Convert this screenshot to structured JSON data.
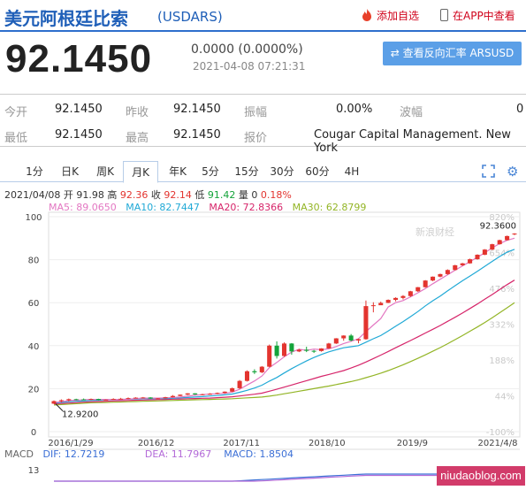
{
  "header": {
    "title": "美元阿根廷比索",
    "code": "(USDARS)",
    "fav_label": "添加自选",
    "app_label": "在APP中查看"
  },
  "quote": {
    "price": "92.1450",
    "change": "0.0000 (0.0000%)",
    "time": "2021-04-08 07:21:31",
    "reverse_button": "查看反向汇率 ARSUSD"
  },
  "stats": {
    "open_label": "今开",
    "open": "92.1450",
    "prev_label": "昨收",
    "prev": "92.1450",
    "amp_label": "振幅",
    "amp": "0.00%",
    "wave_label": "波幅",
    "wave": "0",
    "low_label": "最低",
    "low": "92.1450",
    "high_label": "最高",
    "high": "92.1450",
    "quote_label": "报价",
    "quoter": "Cougar Capital Management. New York"
  },
  "tabs": [
    "1分",
    "日K",
    "周K",
    "月K",
    "年K",
    "5分",
    "15分",
    "30分",
    "60分",
    "4H"
  ],
  "active_tab": "月K",
  "ohlc": {
    "date": "2021/04/08",
    "open_label": "开",
    "open": "91.98",
    "high_label": "高",
    "high": "92.36",
    "close_label": "收",
    "close": "92.14",
    "low_label": "低",
    "low": "91.42",
    "vol_label": "量",
    "vol": "0",
    "pct": "0.18%"
  },
  "ma": {
    "ma5": "MA5: 89.0650",
    "ma10": "MA10: 82.7447",
    "ma20": "MA20: 72.8366",
    "ma30": "MA30: 62.8799",
    "colors": {
      "ma5": "#e377c2",
      "ma10": "#20a9d6",
      "ma20": "#d6256a",
      "ma30": "#93b526"
    }
  },
  "macd": {
    "label": "MACD",
    "dif": "DIF: 12.7219",
    "dea": "DEA: 11.7967",
    "macd": "MACD: 1.8504",
    "axis": [
      "13"
    ]
  },
  "watermark": {
    "chart": "新浪财经",
    "corner": "niudaoblog.com"
  },
  "chart_data": {
    "type": "candlestick",
    "y_ticks": [
      "100",
      "80",
      "60",
      "40",
      "20",
      "0"
    ],
    "pct_ticks": [
      "820%",
      "654%",
      "476%",
      "332%",
      "188%",
      "44%",
      "-100%"
    ],
    "x_labels": [
      "2016/1/29",
      "2016/12",
      "2017/11",
      "2018/10",
      "2019/9",
      "2021/4/8"
    ],
    "ylim": [
      0,
      100
    ],
    "max_label": "92.3600",
    "min_label": "12.9200",
    "colors": {
      "up": "#e3342f",
      "down": "#14a33a"
    },
    "candles": [
      [
        13.0,
        14.5,
        12.9,
        14.2
      ],
      [
        14.2,
        15.0,
        13.6,
        14.6
      ],
      [
        14.6,
        15.4,
        14.0,
        15.1
      ],
      [
        15.1,
        15.3,
        14.6,
        15.0
      ],
      [
        15.0,
        15.4,
        14.8,
        14.9
      ],
      [
        14.9,
        15.4,
        14.7,
        15.2
      ],
      [
        15.2,
        15.3,
        14.6,
        14.7
      ],
      [
        14.7,
        15.0,
        14.6,
        14.9
      ],
      [
        14.9,
        15.5,
        14.8,
        15.2
      ],
      [
        15.2,
        15.7,
        15.0,
        15.3
      ],
      [
        15.3,
        15.9,
        15.1,
        15.6
      ],
      [
        15.6,
        16.0,
        15.5,
        15.8
      ],
      [
        15.8,
        16.1,
        15.5,
        15.9
      ],
      [
        15.9,
        16.0,
        15.3,
        15.4
      ],
      [
        15.4,
        15.6,
        15.2,
        15.5
      ],
      [
        15.5,
        16.2,
        15.4,
        16.0
      ],
      [
        16.0,
        17.0,
        15.9,
        16.6
      ],
      [
        16.6,
        17.3,
        16.5,
        17.2
      ],
      [
        17.2,
        17.9,
        17.0,
        17.8
      ],
      [
        17.8,
        17.9,
        17.1,
        17.3
      ],
      [
        17.3,
        17.6,
        16.9,
        17.4
      ],
      [
        17.4,
        17.9,
        17.2,
        17.6
      ],
      [
        17.6,
        18.2,
        17.4,
        18.0
      ],
      [
        18.0,
        18.7,
        17.7,
        18.6
      ],
      [
        18.6,
        20.5,
        18.4,
        20.2
      ],
      [
        20.2,
        24.0,
        19.8,
        23.6
      ],
      [
        23.6,
        28.5,
        23.3,
        28.1
      ],
      [
        28.1,
        29.0,
        26.8,
        27.6
      ],
      [
        27.6,
        30.5,
        27.2,
        30.2
      ],
      [
        30.2,
        40.5,
        30.0,
        40.0
      ],
      [
        40.0,
        42.0,
        34.0,
        35.2
      ],
      [
        35.2,
        41.5,
        34.8,
        41.0
      ],
      [
        41.0,
        41.2,
        35.8,
        37.3
      ],
      [
        37.3,
        38.5,
        37.0,
        38.1
      ],
      [
        38.1,
        39.5,
        37.0,
        37.6
      ],
      [
        37.6,
        38.0,
        36.6,
        37.5
      ],
      [
        37.5,
        38.8,
        37.2,
        38.7
      ],
      [
        38.7,
        41.3,
        38.6,
        41.0
      ],
      [
        41.0,
        43.5,
        40.8,
        43.4
      ],
      [
        43.4,
        44.8,
        42.3,
        44.7
      ],
      [
        44.7,
        45.4,
        42.0,
        42.4
      ],
      [
        42.4,
        43.3,
        41.1,
        43.0
      ],
      [
        43.0,
        61.0,
        42.8,
        58.4
      ],
      [
        58.4,
        60.2,
        55.5,
        58.8
      ],
      [
        58.8,
        60.5,
        59.0,
        59.9
      ],
      [
        59.9,
        61.5,
        59.8,
        61.3
      ],
      [
        61.3,
        62.5,
        60.6,
        62.2
      ],
      [
        62.2,
        63.5,
        61.5,
        63.1
      ],
      [
        63.1,
        65.5,
        62.7,
        65.3
      ],
      [
        65.3,
        67.3,
        65.0,
        67.2
      ],
      [
        67.2,
        70.5,
        67.0,
        70.3
      ],
      [
        70.3,
        72.2,
        70.0,
        72.1
      ],
      [
        72.1,
        73.5,
        71.8,
        73.3
      ],
      [
        73.3,
        75.5,
        73.0,
        75.2
      ],
      [
        75.2,
        77.6,
        75.0,
        77.4
      ],
      [
        77.4,
        78.5,
        77.1,
        78.3
      ],
      [
        78.3,
        80.5,
        78.1,
        80.2
      ],
      [
        80.2,
        82.5,
        80.0,
        82.3
      ],
      [
        82.3,
        84.9,
        82.1,
        84.7
      ],
      [
        84.7,
        87.4,
        84.5,
        87.2
      ],
      [
        87.2,
        89.3,
        87.0,
        89.1
      ],
      [
        89.1,
        91.2,
        88.9,
        91.0
      ],
      [
        91.98,
        92.36,
        91.42,
        92.14
      ]
    ],
    "ma5": [
      13.5,
      14.0,
      14.4,
      14.6,
      14.8,
      15.0,
      15.0,
      15.0,
      15.0,
      15.0,
      15.1,
      15.4,
      15.6,
      15.6,
      15.6,
      15.7,
      15.9,
      16.1,
      16.5,
      16.9,
      17.2,
      17.5,
      17.6,
      17.8,
      18.4,
      19.7,
      21.7,
      23.6,
      25.9,
      29.8,
      32.2,
      34.8,
      37.0,
      38.3,
      37.8,
      38.4,
      38.1,
      38.5,
      39.6,
      41.0,
      42.0,
      43.2,
      46.5,
      49.6,
      52.6,
      58.0,
      60.0,
      61.0,
      62.7,
      64.6,
      66.6,
      68.8,
      70.9,
      73.0,
      75.1,
      77.1,
      79.1,
      81.1,
      83.2,
      85.5,
      87.5,
      89.0,
      90.0
    ],
    "ma10": [
      13.3,
      13.6,
      13.9,
      14.1,
      14.3,
      14.5,
      14.6,
      14.8,
      14.9,
      15.0,
      15.1,
      15.2,
      15.3,
      15.3,
      15.4,
      15.4,
      15.5,
      15.7,
      15.9,
      16.1,
      16.3,
      16.6,
      16.8,
      17.1,
      17.5,
      18.3,
      19.2,
      20.3,
      21.6,
      23.5,
      25.2,
      27.3,
      29.3,
      31.1,
      32.9,
      34.5,
      35.9,
      37.1,
      38.1,
      39.0,
      39.5,
      40.0,
      41.6,
      43.2,
      44.7,
      46.8,
      49.0,
      51.2,
      53.5,
      55.9,
      58.5,
      60.9,
      63.1,
      65.5,
      67.9,
      70.2,
      72.4,
      74.6,
      76.9,
      79.2,
      81.5,
      83.5,
      84.8
    ],
    "ma20": [
      12.9,
      13.1,
      13.3,
      13.5,
      13.7,
      13.9,
      14.0,
      14.1,
      14.3,
      14.4,
      14.5,
      14.6,
      14.7,
      14.8,
      14.9,
      15.0,
      15.1,
      15.2,
      15.3,
      15.4,
      15.5,
      15.6,
      15.8,
      16.0,
      16.2,
      16.6,
      17.0,
      17.4,
      17.9,
      18.8,
      19.7,
      20.7,
      21.7,
      22.7,
      23.7,
      24.7,
      25.7,
      26.6,
      27.5,
      28.4,
      29.6,
      30.9,
      32.4,
      34.0,
      35.6,
      37.3,
      39.0,
      40.7,
      42.4,
      44.1,
      45.9,
      47.6,
      49.4,
      51.3,
      53.2,
      55.2,
      57.3,
      59.4,
      61.6,
      63.8,
      66.1,
      68.4,
      70.5
    ],
    "ma30": [
      12.4,
      12.6,
      12.8,
      13.0,
      13.2,
      13.4,
      13.5,
      13.6,
      13.7,
      13.8,
      13.9,
      14.0,
      14.1,
      14.2,
      14.3,
      14.4,
      14.5,
      14.6,
      14.7,
      14.8,
      14.9,
      15.0,
      15.1,
      15.2,
      15.3,
      15.5,
      15.7,
      15.9,
      16.1,
      16.5,
      17.0,
      17.6,
      18.2,
      18.8,
      19.4,
      20.0,
      20.6,
      21.2,
      21.9,
      22.6,
      23.3,
      24.1,
      25.1,
      26.1,
      27.2,
      28.4,
      29.7,
      31.1,
      32.6,
      34.1,
      35.7,
      37.4,
      39.1,
      40.9,
      42.8,
      44.7,
      46.7,
      48.7,
      50.8,
      53.0,
      55.3,
      57.6,
      60.0
    ]
  }
}
